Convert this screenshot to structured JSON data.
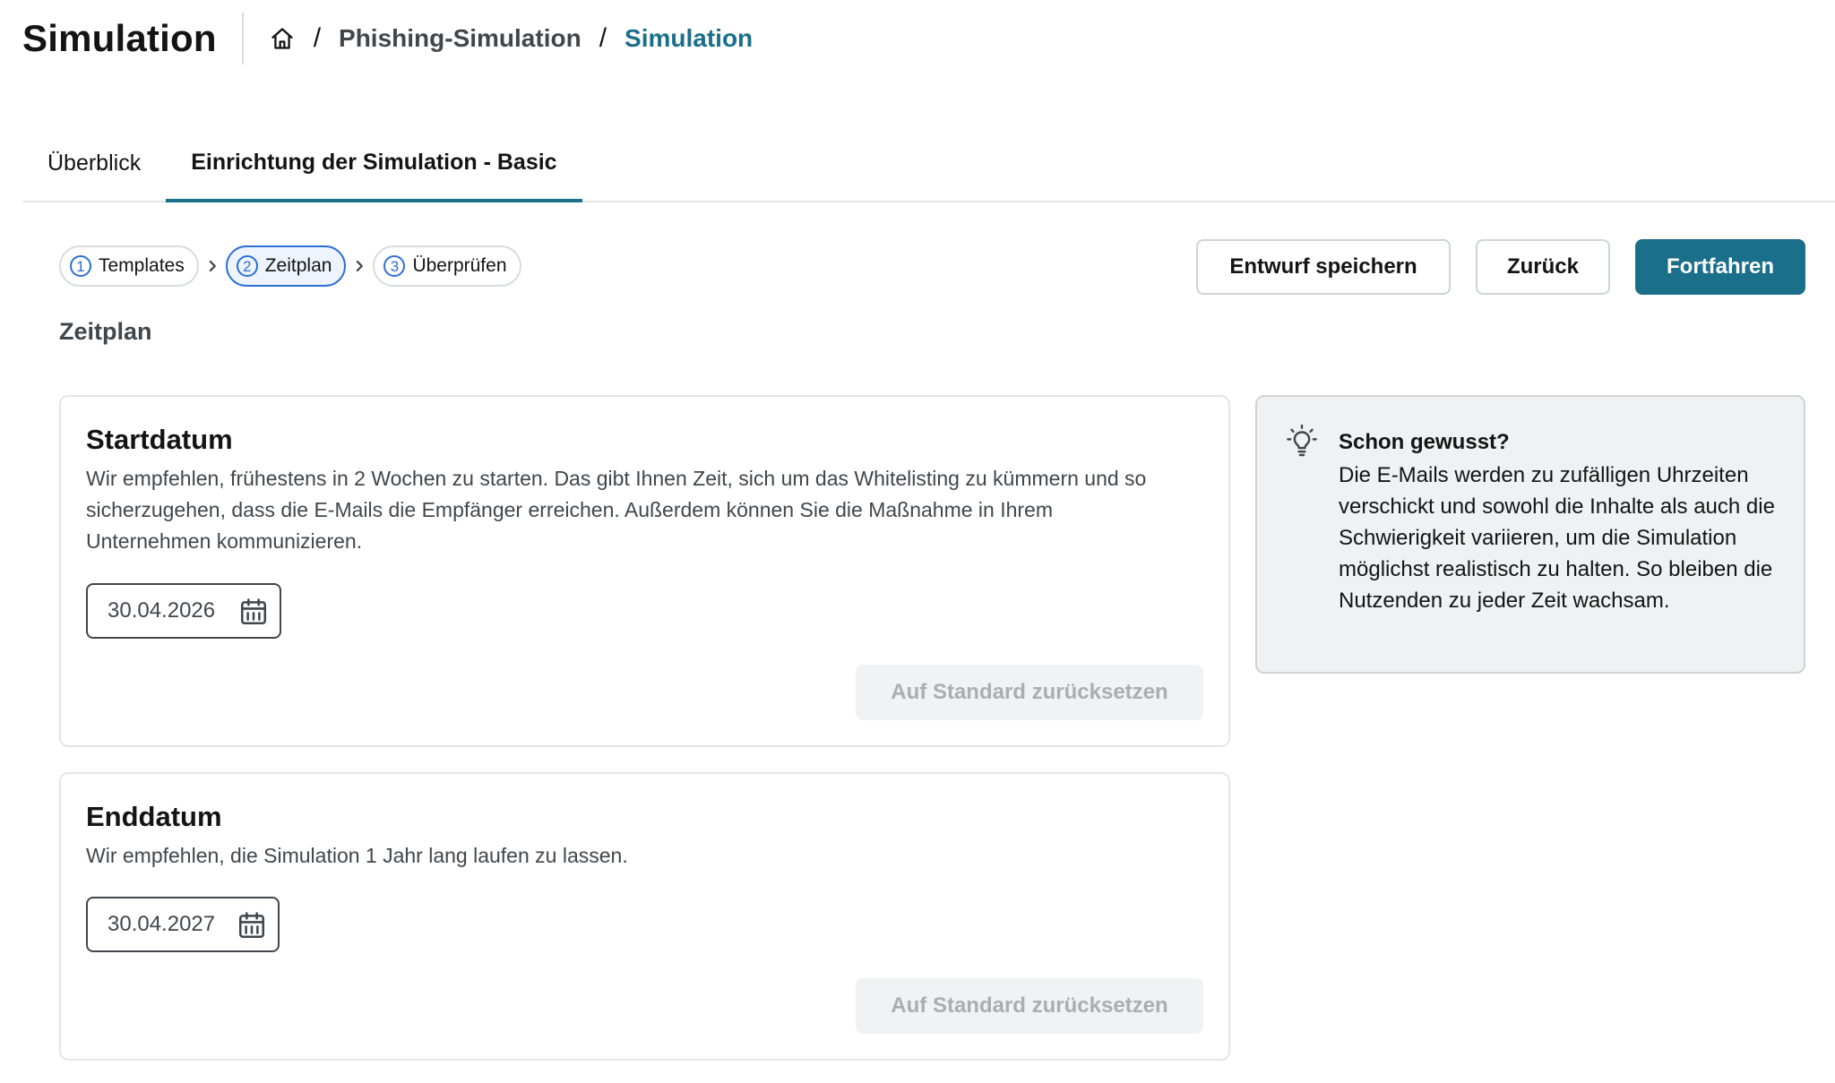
{
  "header": {
    "title": "Simulation",
    "breadcrumb": {
      "home_icon": "home-icon",
      "separator": "/",
      "items": [
        "Phishing-Simulation",
        "Simulation"
      ]
    }
  },
  "tabs": [
    {
      "label": "Überblick",
      "active": false
    },
    {
      "label": "Einrichtung der Simulation - Basic",
      "active": true
    }
  ],
  "stepper": {
    "steps": [
      {
        "number": "1",
        "label": "Templates",
        "active": false
      },
      {
        "number": "2",
        "label": "Zeitplan",
        "active": true
      },
      {
        "number": "3",
        "label": "Überprüfen",
        "active": false
      }
    ],
    "chevron_icon": "chevron-right-icon"
  },
  "actions": {
    "save_draft": "Entwurf speichern",
    "back": "Zurück",
    "continue": "Fortfahren"
  },
  "section_title": "Zeitplan",
  "start_card": {
    "title": "Startdatum",
    "description": "Wir empfehlen, frühestens in 2 Wochen zu starten. Das gibt Ihnen Zeit, sich um das Whitelisting zu kümmern und so sicherzugehen, dass die E-Mails die Empfänger erreichen. Außerdem können Sie die Maßnahme in Ihrem Unternehmen kommunizieren.",
    "date_value": "30.04.2026",
    "calendar_icon": "calendar-icon",
    "reset_label": "Auf Standard zurücksetzen",
    "reset_disabled": true
  },
  "end_card": {
    "title": "Enddatum",
    "description": "Wir empfehlen, die Simulation 1 Jahr lang laufen zu lassen.",
    "date_value": "30.04.2027",
    "calendar_icon": "calendar-icon",
    "reset_label": "Auf Standard zurücksetzen",
    "reset_disabled": true
  },
  "tip": {
    "icon": "lightbulb-icon",
    "title": "Schon gewusst?",
    "text": "Die E-Mails werden zu zufälligen Uhrzeiten verschickt und sowohl die Inhalte als auch die Schwierigkeit variieren, um die Simulation möglichst realistisch zu halten. So bleiben die Nutzenden zu jeder Zeit wachsam."
  },
  "colors": {
    "accent": "#1a6f8a",
    "step_active": "#2b6fd6",
    "text_secondary": "#3f474d",
    "disabled_text": "#a9aeb3"
  }
}
